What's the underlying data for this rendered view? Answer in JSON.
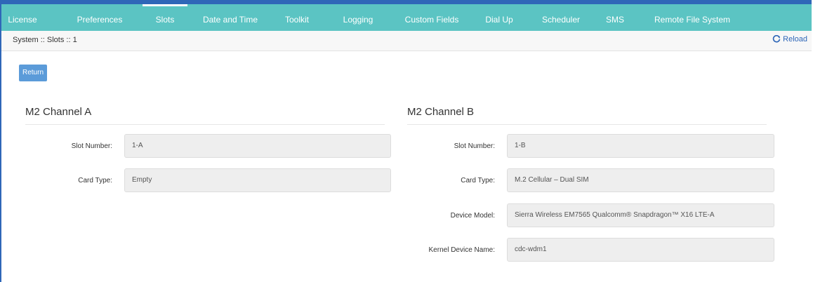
{
  "tabs": [
    {
      "label": "License"
    },
    {
      "label": "Preferences"
    },
    {
      "label": "Slots"
    },
    {
      "label": "Date and Time"
    },
    {
      "label": "Toolkit"
    },
    {
      "label": "Logging"
    },
    {
      "label": "Custom Fields"
    },
    {
      "label": "Dial Up"
    },
    {
      "label": "Scheduler"
    },
    {
      "label": "SMS"
    },
    {
      "label": "Remote File System"
    }
  ],
  "breadcrumb": "System :: Slots :: 1",
  "reload_label": "Reload",
  "return_label": "Return",
  "channel_a": {
    "title": "M2 Channel A",
    "slot_number_label": "Slot Number:",
    "slot_number": "1-A",
    "card_type_label": "Card Type:",
    "card_type": "Empty"
  },
  "channel_b": {
    "title": "M2 Channel B",
    "slot_number_label": "Slot Number:",
    "slot_number": "1-B",
    "card_type_label": "Card Type:",
    "card_type": "M.2 Cellular – Dual SIM",
    "device_model_label": "Device Model:",
    "device_model": "Sierra Wireless EM7565 Qualcomm® Snapdragon™ X16 LTE-A",
    "kernel_label": "Kernel Device Name:",
    "kernel": "cdc-wdm1"
  }
}
